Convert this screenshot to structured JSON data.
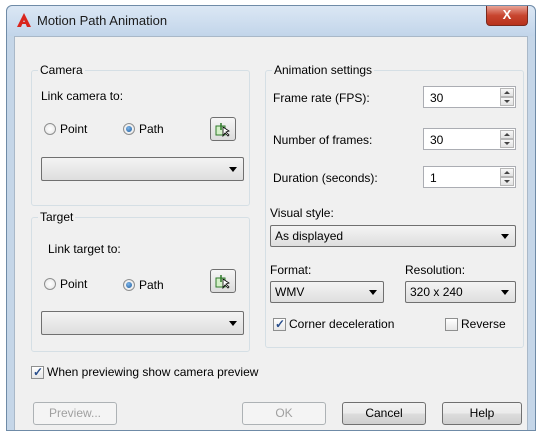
{
  "window": {
    "title": "Motion Path Animation",
    "close_label": "X"
  },
  "camera": {
    "legend": "Camera",
    "link_label": "Link camera to:",
    "radio_point": "Point",
    "radio_path": "Path",
    "selected": "Path",
    "path_select_value": ""
  },
  "target": {
    "legend": "Target",
    "link_label": "Link target to:",
    "radio_point": "Point",
    "radio_path": "Path",
    "selected": "Path",
    "path_select_value": ""
  },
  "animation": {
    "legend": "Animation settings",
    "frame_rate_label": "Frame rate (FPS):",
    "frame_rate_value": "30",
    "frames_label": "Number of frames:",
    "frames_value": "30",
    "duration_label": "Duration (seconds):",
    "duration_value": "1",
    "visual_style_label": "Visual style:",
    "visual_style_value": "As displayed",
    "format_label": "Format:",
    "format_value": "WMV",
    "resolution_label": "Resolution:",
    "resolution_value": "320 x 240",
    "corner_decel_label": "Corner deceleration",
    "corner_decel_checked": true,
    "reverse_label": "Reverse",
    "reverse_checked": false
  },
  "preview_checkbox": {
    "label": "When previewing show camera preview",
    "checked": true
  },
  "buttons": {
    "preview": "Preview...",
    "ok": "OK",
    "cancel": "Cancel",
    "help": "Help"
  },
  "colors": {
    "accent_radio": "#1c5a9a",
    "app_icon": "#d9251d"
  }
}
